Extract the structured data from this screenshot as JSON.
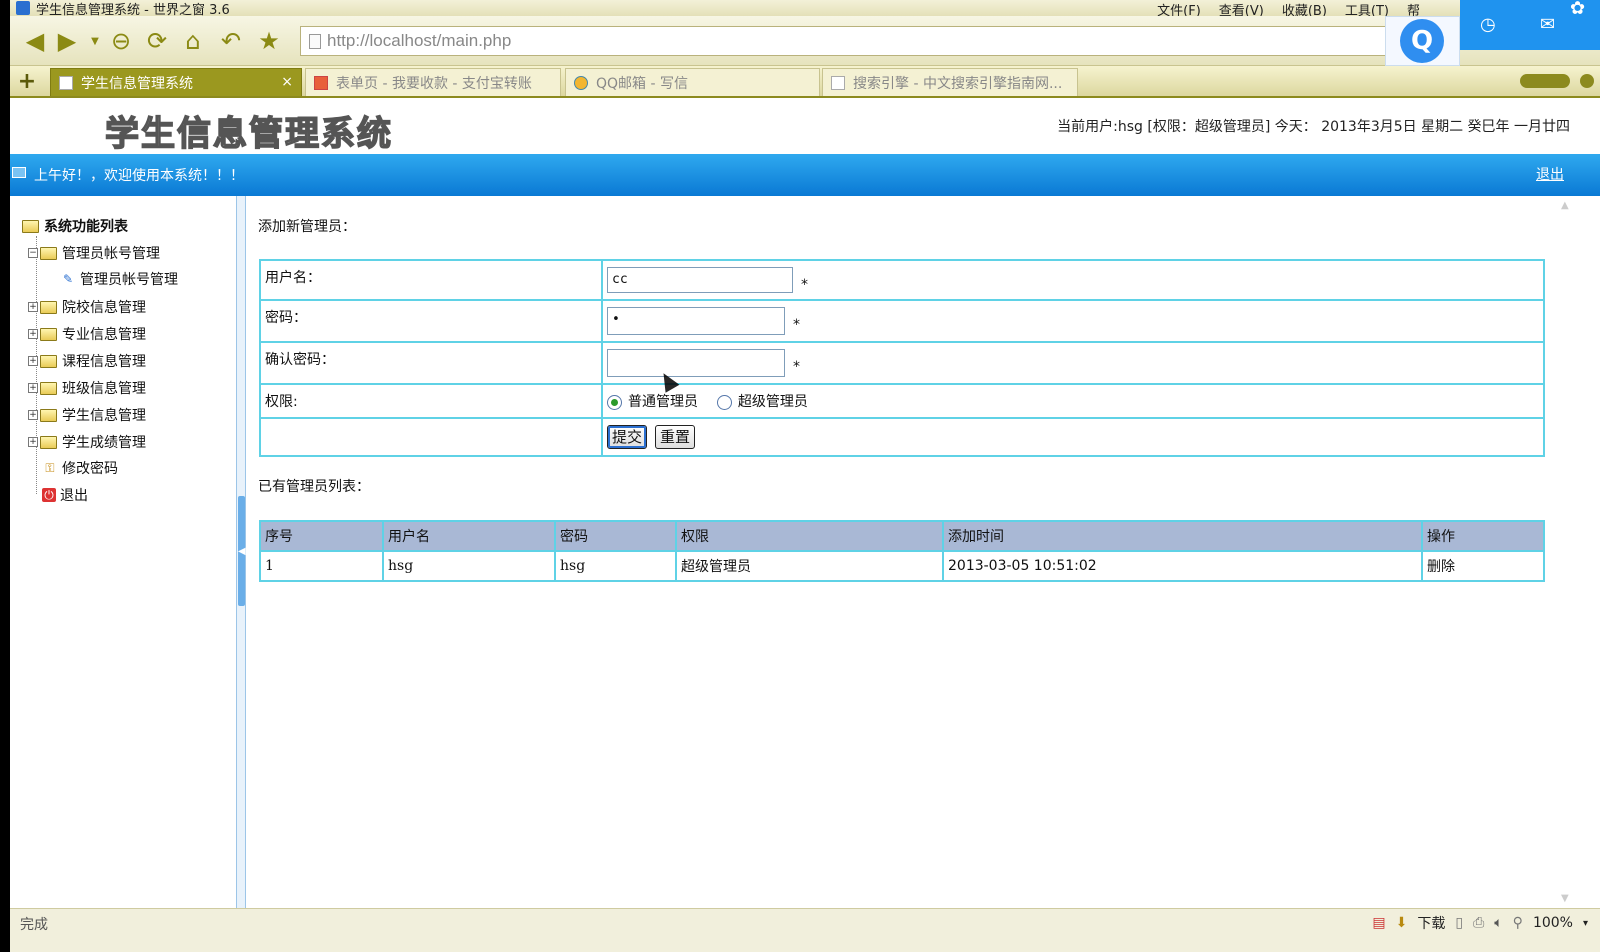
{
  "browser": {
    "title": "学生信息管理系统 - 世界之窗 3.6",
    "menu": [
      "文件(F)",
      "查看(V)",
      "收藏(B)",
      "工具(T)",
      "帮"
    ],
    "url": "http://localhost/main.php",
    "tabs": [
      {
        "label": "学生信息管理系统",
        "active": true
      },
      {
        "label": "表单页 - 我要收款 - 支付宝转账",
        "active": false
      },
      {
        "label": "QQ邮箱 - 写信",
        "active": false
      },
      {
        "label": "搜索引擎 - 中文搜索引擎指南网...",
        "active": false
      }
    ],
    "status": "完成",
    "download": "下载",
    "zoom": "100%",
    "qq_label": "Q"
  },
  "header": {
    "logo": "学生信息管理系统",
    "user_info": "当前用户:hsg [权限：超级管理员] 今天： 2013年3月5日 星期二 癸巳年 一月廿四"
  },
  "bluebar": {
    "welcome": "上午好！，欢迎使用本系统！！！",
    "logout": "退出"
  },
  "sidebar": {
    "root": "系统功能列表",
    "items": [
      {
        "label": "管理员帐号管理",
        "expanded": true
      },
      {
        "label": "管理员帐号管理",
        "child": true
      },
      {
        "label": "院校信息管理"
      },
      {
        "label": "专业信息管理"
      },
      {
        "label": "课程信息管理"
      },
      {
        "label": "班级信息管理"
      },
      {
        "label": "学生信息管理"
      },
      {
        "label": "学生成绩管理"
      },
      {
        "label": "修改密码"
      },
      {
        "label": "退出"
      }
    ]
  },
  "form": {
    "title": "添加新管理员：",
    "username_label": "用户名：",
    "username_value": "cc",
    "password_label": "密码：",
    "password_value": "•",
    "confirm_label": "确认密码：",
    "confirm_value": "",
    "required": "*",
    "role_label": "权限:",
    "role_options": [
      "普通管理员",
      "超级管理员"
    ],
    "selected_role": "普通管理员",
    "submit": "提交",
    "reset": "重置"
  },
  "list": {
    "title": "已有管理员列表：",
    "columns": [
      "序号",
      "用户名",
      "密码",
      "权限",
      "添加时间",
      "操作"
    ],
    "rows": [
      {
        "id": "1",
        "username": "hsg",
        "password": "hsg",
        "role": "超级管理员",
        "time": "2013-03-05 10:51:02",
        "action": "删除"
      }
    ]
  },
  "colors": {
    "accent_blue": "#1a8fe3",
    "table_border": "#5fd2e6",
    "table_header": "#a9b8d5",
    "tab_active": "#9b981f"
  }
}
